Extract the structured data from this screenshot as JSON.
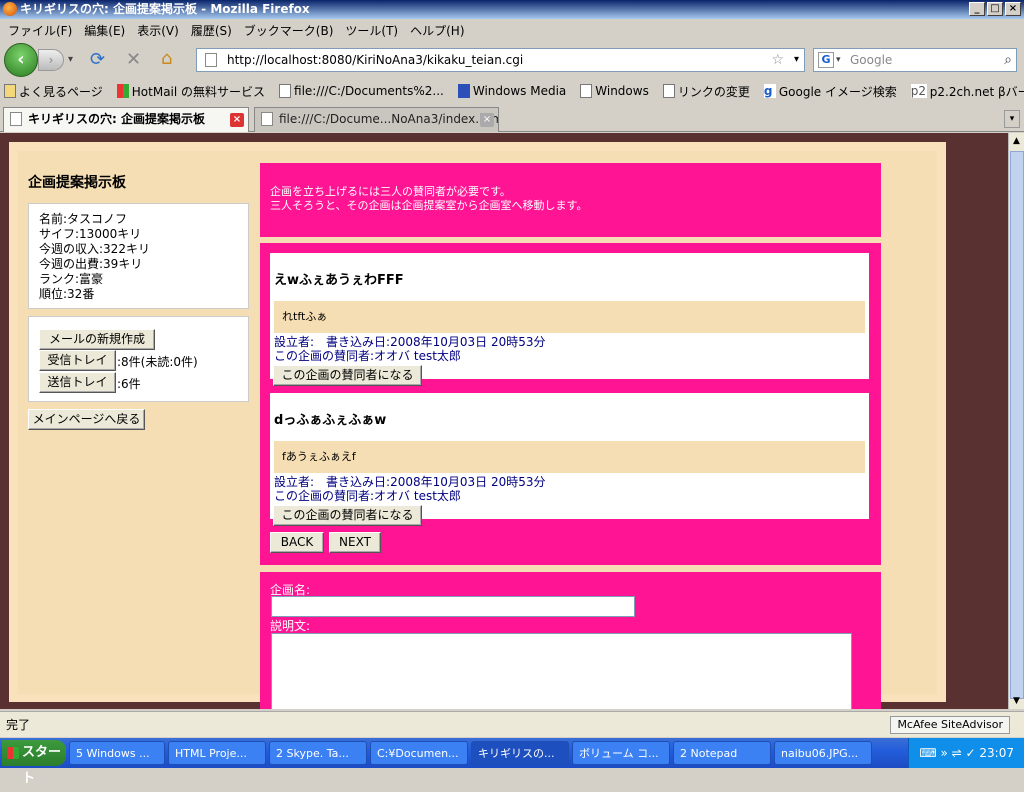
{
  "window": {
    "title": "キリギリスの穴: 企画提案掲示板 - Mozilla Firefox"
  },
  "menu": [
    "ファイル(F)",
    "編集(E)",
    "表示(V)",
    "履歴(S)",
    "ブックマーク(B)",
    "ツール(T)",
    "ヘルプ(H)"
  ],
  "nav": {
    "url": "http://localhost:8080/KiriNoAna3/kikaku_teian.cgi",
    "search_placeholder": "Google"
  },
  "bookmarks": [
    "よく見るページ",
    "HotMail の無料サービス",
    "file:///C:/Documents%2...",
    "Windows Media",
    "Windows",
    "リンクの変更",
    "Google イメージ検索",
    "p2.2ch.net βバージョン"
  ],
  "tabs": [
    {
      "label": "キリギリスの穴: 企画提案掲示板"
    },
    {
      "label": "file:///C:/Docume...NoAna3/index.html"
    }
  ],
  "status": {
    "text": "完了",
    "mcafee": "McAfee SiteAdvisor"
  },
  "taskbar": {
    "start": "スタート",
    "items": [
      "5 Windows ...",
      "HTML Proje...",
      "2 Skype. Ta...",
      "C:¥Documen...",
      "キリギリスの...",
      "ボリューム コ...",
      "2 Notepad",
      "naibu06.JPG..."
    ],
    "clock": "23:07"
  },
  "sidebar": {
    "title": "企画提案掲示板",
    "profile": [
      "名前:タスコノフ",
      "サイフ:13000キリ",
      "今週の収入:322キリ",
      "今週の出費:39キリ",
      "ランク:富豪",
      "順位:32番"
    ],
    "new_mail": "メールの新規作成",
    "inbox": "受信トレイ",
    "inbox_count": ":8件(未読:0件)",
    "outbox": "送信トレイ",
    "outbox_count": ":6件",
    "back_main": "メインページへ戻る"
  },
  "notice": {
    "line1": "企画を立ち上げるには三人の賛同者が必要です。",
    "line2": "三人そろうと、その企画は企画提案室から企画室へ移動します。"
  },
  "posts": [
    {
      "title": "えwふぇあうぇわFFF",
      "body": "れtftふぁ",
      "meta1": "設立者:　書き込み日:2008年10月03日 20時53分",
      "meta2": "この企画の賛同者:オオバ test太郎",
      "button": "この企画の賛同者になる"
    },
    {
      "title": "dっふぁふぇふぁw",
      "body": "fあうぇふぁえf",
      "meta1": "設立者:　書き込み日:2008年10月03日 20時53分",
      "meta2": "この企画の賛同者:オオバ test太郎",
      "button": "この企画の賛同者になる"
    }
  ],
  "pager": {
    "back": "BACK",
    "next": "NEXT"
  },
  "form": {
    "name_label": "企画名:",
    "desc_label": "説明文:"
  },
  "colors": {
    "accent": "#ff1493",
    "panel": "#f5deb3",
    "background": "#5a3131"
  }
}
